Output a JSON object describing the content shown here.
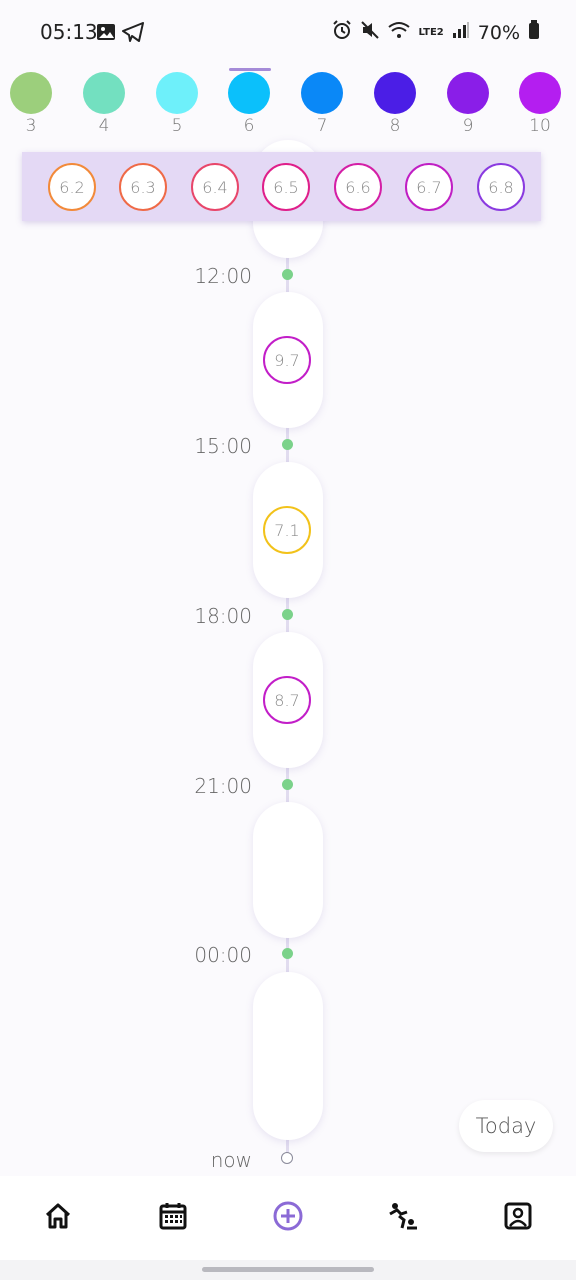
{
  "status_bar": {
    "time": "05:13",
    "battery": "70%",
    "network": "LTE2",
    "icons_left": [
      "gallery-icon",
      "telegram-icon"
    ],
    "icons_right": [
      "alarm-icon",
      "mute-icon",
      "wifi-icon",
      "signal-icon",
      "battery-icon"
    ]
  },
  "scale": {
    "selected": "6",
    "items": [
      {
        "label": "3",
        "color": "#9ccf7c"
      },
      {
        "label": "4",
        "color": "#73e0c0"
      },
      {
        "label": "5",
        "color": "#6ef0fa"
      },
      {
        "label": "6",
        "color": "#0bc0fb"
      },
      {
        "label": "7",
        "color": "#0a88f7"
      },
      {
        "label": "8",
        "color": "#4b1ee6"
      },
      {
        "label": "9",
        "color": "#8a1ee8"
      },
      {
        "label": "10",
        "color": "#b41ef0"
      }
    ]
  },
  "sub_values": [
    {
      "label": "6.2",
      "color": "#f28a3a"
    },
    {
      "label": "6.3",
      "color": "#ef6a47"
    },
    {
      "label": "6.4",
      "color": "#e8466a"
    },
    {
      "label": "6.5",
      "color": "#df1f8a"
    },
    {
      "label": "6.6",
      "color": "#d41fa6"
    },
    {
      "label": "6.7",
      "color": "#c01fc4"
    },
    {
      "label": "6.8",
      "color": "#8a3ae0"
    }
  ],
  "timeline": {
    "times": [
      "12:00",
      "15:00",
      "18:00",
      "21:00",
      "00:00"
    ],
    "now_label": "now",
    "entries": [
      {
        "value": "9.7",
        "color": "#c21ec8"
      },
      {
        "value": "7.1",
        "color": "#f2c21a"
      },
      {
        "value": "8.7",
        "color": "#c21ec8"
      }
    ]
  },
  "today_label": "Today",
  "nav": {
    "items": [
      "home-icon",
      "calendar-icon",
      "add-icon",
      "activity-icon",
      "profile-icon"
    ],
    "accent": "#8b6ad6"
  }
}
